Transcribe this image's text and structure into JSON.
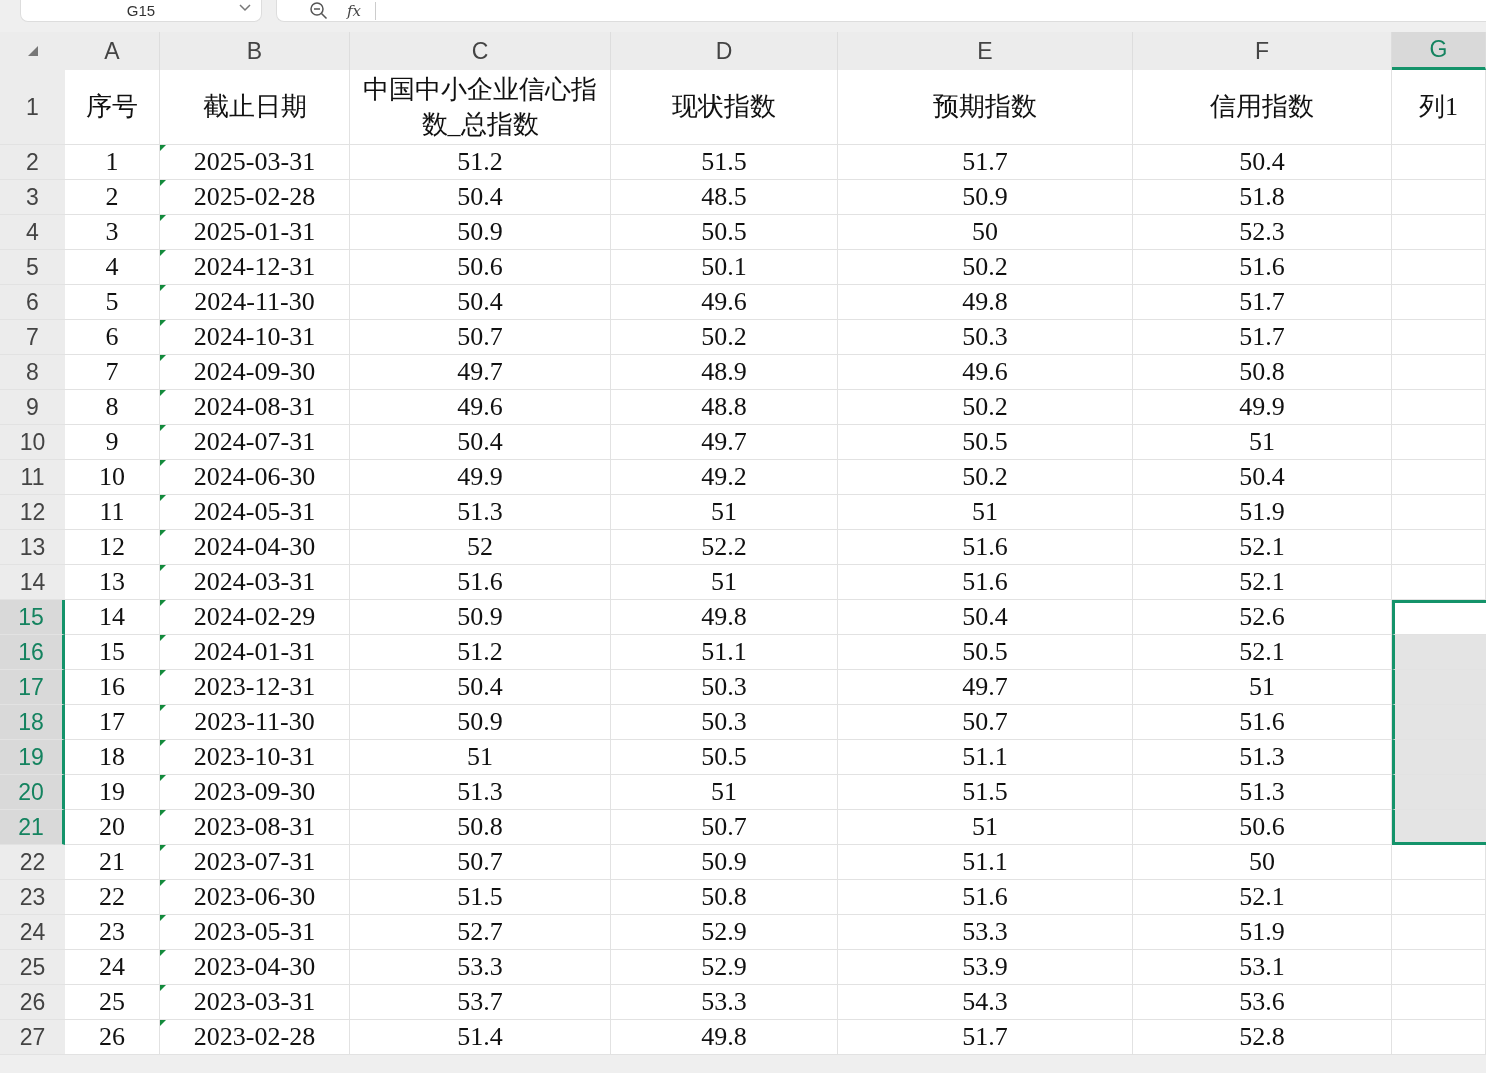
{
  "name_box": "G15",
  "formula_bar": {
    "label": "fx"
  },
  "columns": [
    {
      "label": "A",
      "selected": false
    },
    {
      "label": "B",
      "selected": false
    },
    {
      "label": "C",
      "selected": false
    },
    {
      "label": "D",
      "selected": false
    },
    {
      "label": "E",
      "selected": false
    },
    {
      "label": "F",
      "selected": false
    },
    {
      "label": "G",
      "selected": true
    }
  ],
  "rows": [
    {
      "number": "1",
      "selected": false,
      "text_flag": false,
      "cells": [
        "序号",
        "截止日期",
        "中国中小企业信心指数_总指数",
        "现状指数",
        "预期指数",
        "信用指数",
        "列1"
      ]
    },
    {
      "number": "2",
      "selected": false,
      "text_flag": true,
      "cells": [
        "1",
        "2025-03-31",
        "51.2",
        "51.5",
        "51.7",
        "50.4"
      ]
    },
    {
      "number": "3",
      "selected": false,
      "text_flag": true,
      "cells": [
        "2",
        "2025-02-28",
        "50.4",
        "48.5",
        "50.9",
        "51.8"
      ]
    },
    {
      "number": "4",
      "selected": false,
      "text_flag": true,
      "cells": [
        "3",
        "2025-01-31",
        "50.9",
        "50.5",
        "50",
        "52.3"
      ]
    },
    {
      "number": "5",
      "selected": false,
      "text_flag": true,
      "cells": [
        "4",
        "2024-12-31",
        "50.6",
        "50.1",
        "50.2",
        "51.6"
      ]
    },
    {
      "number": "6",
      "selected": false,
      "text_flag": true,
      "cells": [
        "5",
        "2024-11-30",
        "50.4",
        "49.6",
        "49.8",
        "51.7"
      ]
    },
    {
      "number": "7",
      "selected": false,
      "text_flag": true,
      "cells": [
        "6",
        "2024-10-31",
        "50.7",
        "50.2",
        "50.3",
        "51.7"
      ]
    },
    {
      "number": "8",
      "selected": false,
      "text_flag": true,
      "cells": [
        "7",
        "2024-09-30",
        "49.7",
        "48.9",
        "49.6",
        "50.8"
      ]
    },
    {
      "number": "9",
      "selected": false,
      "text_flag": true,
      "cells": [
        "8",
        "2024-08-31",
        "49.6",
        "48.8",
        "50.2",
        "49.9"
      ]
    },
    {
      "number": "10",
      "selected": false,
      "text_flag": true,
      "cells": [
        "9",
        "2024-07-31",
        "50.4",
        "49.7",
        "50.5",
        "51"
      ]
    },
    {
      "number": "11",
      "selected": false,
      "text_flag": true,
      "cells": [
        "10",
        "2024-06-30",
        "49.9",
        "49.2",
        "50.2",
        "50.4"
      ]
    },
    {
      "number": "12",
      "selected": false,
      "text_flag": true,
      "cells": [
        "11",
        "2024-05-31",
        "51.3",
        "51",
        "51",
        "51.9"
      ]
    },
    {
      "number": "13",
      "selected": false,
      "text_flag": true,
      "cells": [
        "12",
        "2024-04-30",
        "52",
        "52.2",
        "51.6",
        "52.1"
      ]
    },
    {
      "number": "14",
      "selected": false,
      "text_flag": true,
      "cells": [
        "13",
        "2024-03-31",
        "51.6",
        "51",
        "51.6",
        "52.1"
      ]
    },
    {
      "number": "15",
      "selected": true,
      "text_flag": true,
      "cells": [
        "14",
        "2024-02-29",
        "50.9",
        "49.8",
        "50.4",
        "52.6"
      ]
    },
    {
      "number": "16",
      "selected": true,
      "text_flag": true,
      "cells": [
        "15",
        "2024-01-31",
        "51.2",
        "51.1",
        "50.5",
        "52.1"
      ]
    },
    {
      "number": "17",
      "selected": true,
      "text_flag": true,
      "cells": [
        "16",
        "2023-12-31",
        "50.4",
        "50.3",
        "49.7",
        "51"
      ]
    },
    {
      "number": "18",
      "selected": true,
      "text_flag": true,
      "cells": [
        "17",
        "2023-11-30",
        "50.9",
        "50.3",
        "50.7",
        "51.6"
      ]
    },
    {
      "number": "19",
      "selected": true,
      "text_flag": true,
      "cells": [
        "18",
        "2023-10-31",
        "51",
        "50.5",
        "51.1",
        "51.3"
      ]
    },
    {
      "number": "20",
      "selected": true,
      "text_flag": true,
      "cells": [
        "19",
        "2023-09-30",
        "51.3",
        "51",
        "51.5",
        "51.3"
      ]
    },
    {
      "number": "21",
      "selected": true,
      "text_flag": true,
      "cells": [
        "20",
        "2023-08-31",
        "50.8",
        "50.7",
        "51",
        "50.6"
      ]
    },
    {
      "number": "22",
      "selected": false,
      "text_flag": true,
      "cells": [
        "21",
        "2023-07-31",
        "50.7",
        "50.9",
        "51.1",
        "50"
      ]
    },
    {
      "number": "23",
      "selected": false,
      "text_flag": true,
      "cells": [
        "22",
        "2023-06-30",
        "51.5",
        "50.8",
        "51.6",
        "52.1"
      ]
    },
    {
      "number": "24",
      "selected": false,
      "text_flag": true,
      "cells": [
        "23",
        "2023-05-31",
        "52.7",
        "52.9",
        "53.3",
        "51.9"
      ]
    },
    {
      "number": "25",
      "selected": false,
      "text_flag": true,
      "cells": [
        "24",
        "2023-04-30",
        "53.3",
        "52.9",
        "53.9",
        "53.1"
      ]
    },
    {
      "number": "26",
      "selected": false,
      "text_flag": true,
      "cells": [
        "25",
        "2023-03-31",
        "53.7",
        "53.3",
        "54.3",
        "53.6"
      ]
    },
    {
      "number": "27",
      "selected": false,
      "text_flag": true,
      "cells": [
        "26",
        "2023-02-28",
        "51.4",
        "49.8",
        "51.7",
        "52.8"
      ]
    }
  ]
}
